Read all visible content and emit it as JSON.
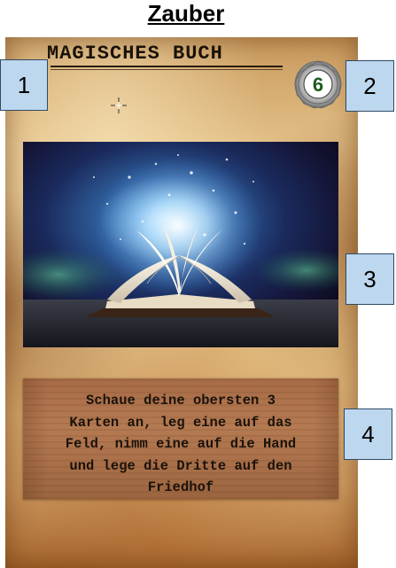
{
  "page": {
    "heading": "Zauber"
  },
  "card": {
    "title": "MAGISCHES BUCH",
    "cost": "6",
    "art_description_icon": "magic-book-illustration",
    "effect_text": "Schaue deine obersten 3\nKarten an, leg eine auf das\nFeld, nimm eine auf die Hand\nund lege die Dritte auf den\nFriedhof"
  },
  "callouts": [
    {
      "label": "1"
    },
    {
      "label": "2"
    },
    {
      "label": "3"
    },
    {
      "label": "4"
    }
  ],
  "colors": {
    "parchment": "#dcb57a",
    "cost_text": "#1f5a1f",
    "callout_fill": "#bdd7ee",
    "text_panel": "#b47a52"
  }
}
